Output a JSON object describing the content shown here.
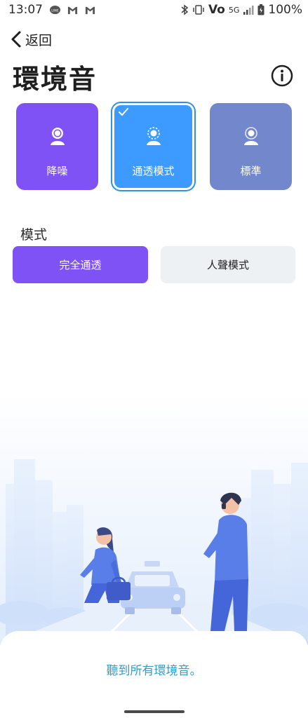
{
  "status_bar": {
    "time": "13:07",
    "left_icons": [
      "line-icon",
      "gmail-icon",
      "gmail-icon"
    ],
    "right_icons": [
      "bluetooth-icon",
      "vibrate-icon",
      "volte-icon",
      "5g-signal-icon",
      "battery-icon"
    ],
    "volte_label": "Vo",
    "network_label": "5G",
    "battery": "100%"
  },
  "header": {
    "back_label": "返回",
    "title": "環境音"
  },
  "mode_cards": [
    {
      "label": "降噪",
      "icon": "person-icon",
      "selected": false,
      "color": "#7f52f6"
    },
    {
      "label": "通透模式",
      "icon": "person-dashed-icon",
      "selected": true,
      "color": "#3d9bff"
    },
    {
      "label": "標準",
      "icon": "person-ring-icon",
      "selected": false,
      "color": "#7287cc"
    }
  ],
  "mode_section": {
    "label": "模式",
    "options": [
      {
        "label": "完全通透",
        "selected": true
      },
      {
        "label": "人聲模式",
        "selected": false
      }
    ]
  },
  "description": "聽到所有環境音。",
  "colors": {
    "accent_purple": "#7f52f6",
    "accent_blue": "#3d9bff",
    "standard_blue": "#7287cc",
    "description_text": "#2f9fd0"
  }
}
